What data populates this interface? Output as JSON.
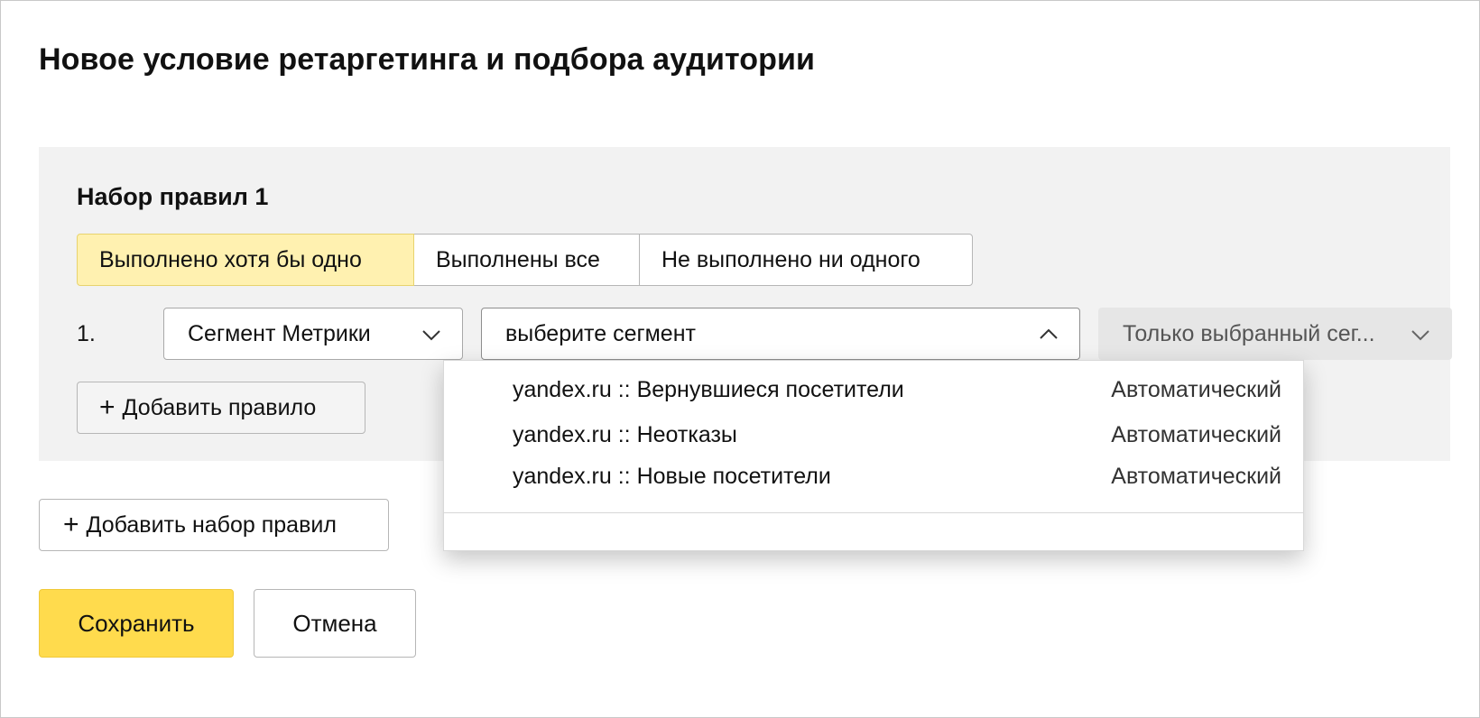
{
  "page": {
    "title": "Новое условие ретаргетинга и подбора аудитории"
  },
  "ruleset": {
    "title": "Набор правил 1",
    "modes": [
      {
        "label": "Выполнено хотя бы одно",
        "active": true
      },
      {
        "label": "Выполнены все",
        "active": false
      },
      {
        "label": "Не выполнено ни одного",
        "active": false
      }
    ],
    "rule": {
      "number": "1.",
      "type_value": "Сегмент Метрики",
      "segment_placeholder": "выберите сегмент",
      "scope_value": "Только выбранный сег..."
    },
    "add_rule_label": "Добавить правило"
  },
  "dropdown": {
    "items": [
      {
        "label": "yandex.ru :: Вернувшиеся посетители",
        "kind": "Автоматический"
      },
      {
        "label": "yandex.ru :: Неотказы",
        "kind": "Автоматический"
      },
      {
        "label": "yandex.ru :: Новые посетители",
        "kind": "Автоматический"
      }
    ]
  },
  "actions": {
    "add_set_label": "Добавить набор правил",
    "save_label": "Сохранить",
    "cancel_label": "Отмена"
  },
  "colors": {
    "active_mode": "#fff1b0",
    "save_button": "#ffdb4d",
    "panel_bg": "#f2f2f2"
  },
  "icons": {
    "dropdown": "chevron-down-icon",
    "dropdown_open": "chevron-up-icon",
    "add": "plus-icon"
  }
}
